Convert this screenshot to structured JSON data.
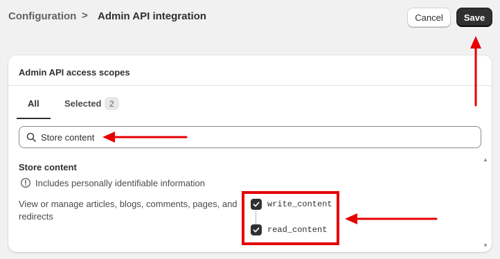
{
  "header": {
    "breadcrumb_parent": "Configuration",
    "breadcrumb_separator": ">",
    "breadcrumb_current": "Admin API integration",
    "cancel_label": "Cancel",
    "save_label": "Save"
  },
  "card": {
    "title": "Admin API access scopes",
    "tabs": [
      {
        "label": "All",
        "active": true
      },
      {
        "label": "Selected",
        "count": "2"
      }
    ],
    "search": {
      "value": "Store content",
      "icon": "search-icon"
    },
    "section": {
      "title": "Store content",
      "pii_notice": "Includes personally identifiable information",
      "pii_icon": "info-circle-icon",
      "description": "View or manage articles, blogs, comments, pages, and redirects",
      "scopes": [
        {
          "label": "write_content",
          "checked": true
        },
        {
          "label": "read_content",
          "checked": true
        }
      ]
    }
  },
  "colors": {
    "annotation": "#e60000",
    "primary_button": "#303030",
    "page_background": "#f1f1f1"
  }
}
